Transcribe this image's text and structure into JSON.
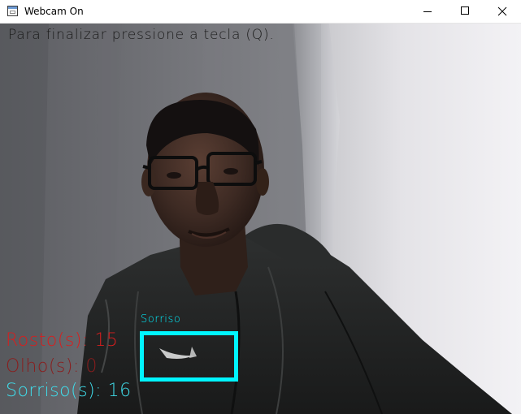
{
  "window": {
    "title": "Webcam On",
    "icon": "app-window-icon",
    "controls": {
      "minimize_icon": "minimize-icon",
      "maximize_icon": "maximize-icon",
      "close_icon": "close-icon"
    }
  },
  "overlay": {
    "instruction": "Para finalizar pressione a tecla (Q).",
    "detection_label": "Sorriso",
    "faces_count": "Rosto(s): 15",
    "eyes_count": "Olho(s): 0",
    "smiles_count": "Sorriso(s): 16",
    "colors": {
      "instruction": "#1a1a1a",
      "faces": "#d81e1e",
      "eyes": "#8a1d1d",
      "smiles": "#3fdcea",
      "detection_box": "#00f5ff"
    }
  }
}
